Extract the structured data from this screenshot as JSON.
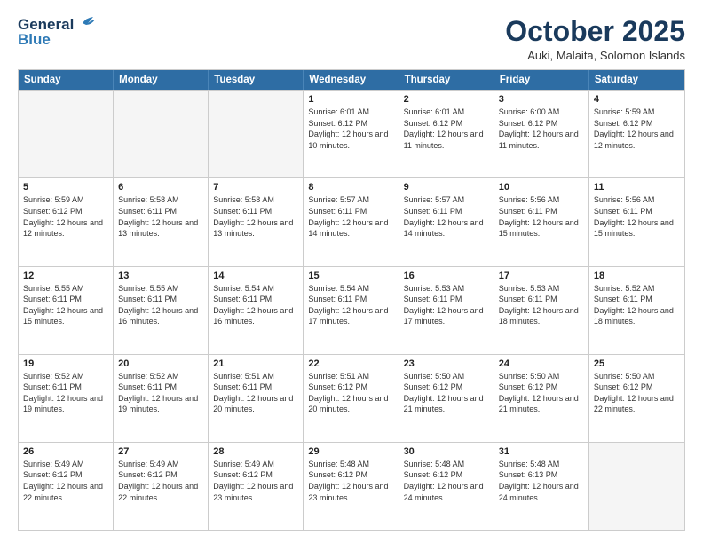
{
  "header": {
    "logo_general": "General",
    "logo_blue": "Blue",
    "month_title": "October 2025",
    "subtitle": "Auki, Malaita, Solomon Islands"
  },
  "calendar": {
    "days_of_week": [
      "Sunday",
      "Monday",
      "Tuesday",
      "Wednesday",
      "Thursday",
      "Friday",
      "Saturday"
    ],
    "weeks": [
      [
        {
          "day": "",
          "empty": true
        },
        {
          "day": "",
          "empty": true
        },
        {
          "day": "",
          "empty": true
        },
        {
          "day": "1",
          "sunrise": "Sunrise: 6:01 AM",
          "sunset": "Sunset: 6:12 PM",
          "daylight": "Daylight: 12 hours and 10 minutes."
        },
        {
          "day": "2",
          "sunrise": "Sunrise: 6:01 AM",
          "sunset": "Sunset: 6:12 PM",
          "daylight": "Daylight: 12 hours and 11 minutes."
        },
        {
          "day": "3",
          "sunrise": "Sunrise: 6:00 AM",
          "sunset": "Sunset: 6:12 PM",
          "daylight": "Daylight: 12 hours and 11 minutes."
        },
        {
          "day": "4",
          "sunrise": "Sunrise: 5:59 AM",
          "sunset": "Sunset: 6:12 PM",
          "daylight": "Daylight: 12 hours and 12 minutes."
        }
      ],
      [
        {
          "day": "5",
          "sunrise": "Sunrise: 5:59 AM",
          "sunset": "Sunset: 6:12 PM",
          "daylight": "Daylight: 12 hours and 12 minutes."
        },
        {
          "day": "6",
          "sunrise": "Sunrise: 5:58 AM",
          "sunset": "Sunset: 6:11 PM",
          "daylight": "Daylight: 12 hours and 13 minutes."
        },
        {
          "day": "7",
          "sunrise": "Sunrise: 5:58 AM",
          "sunset": "Sunset: 6:11 PM",
          "daylight": "Daylight: 12 hours and 13 minutes."
        },
        {
          "day": "8",
          "sunrise": "Sunrise: 5:57 AM",
          "sunset": "Sunset: 6:11 PM",
          "daylight": "Daylight: 12 hours and 14 minutes."
        },
        {
          "day": "9",
          "sunrise": "Sunrise: 5:57 AM",
          "sunset": "Sunset: 6:11 PM",
          "daylight": "Daylight: 12 hours and 14 minutes."
        },
        {
          "day": "10",
          "sunrise": "Sunrise: 5:56 AM",
          "sunset": "Sunset: 6:11 PM",
          "daylight": "Daylight: 12 hours and 15 minutes."
        },
        {
          "day": "11",
          "sunrise": "Sunrise: 5:56 AM",
          "sunset": "Sunset: 6:11 PM",
          "daylight": "Daylight: 12 hours and 15 minutes."
        }
      ],
      [
        {
          "day": "12",
          "sunrise": "Sunrise: 5:55 AM",
          "sunset": "Sunset: 6:11 PM",
          "daylight": "Daylight: 12 hours and 15 minutes."
        },
        {
          "day": "13",
          "sunrise": "Sunrise: 5:55 AM",
          "sunset": "Sunset: 6:11 PM",
          "daylight": "Daylight: 12 hours and 16 minutes."
        },
        {
          "day": "14",
          "sunrise": "Sunrise: 5:54 AM",
          "sunset": "Sunset: 6:11 PM",
          "daylight": "Daylight: 12 hours and 16 minutes."
        },
        {
          "day": "15",
          "sunrise": "Sunrise: 5:54 AM",
          "sunset": "Sunset: 6:11 PM",
          "daylight": "Daylight: 12 hours and 17 minutes."
        },
        {
          "day": "16",
          "sunrise": "Sunrise: 5:53 AM",
          "sunset": "Sunset: 6:11 PM",
          "daylight": "Daylight: 12 hours and 17 minutes."
        },
        {
          "day": "17",
          "sunrise": "Sunrise: 5:53 AM",
          "sunset": "Sunset: 6:11 PM",
          "daylight": "Daylight: 12 hours and 18 minutes."
        },
        {
          "day": "18",
          "sunrise": "Sunrise: 5:52 AM",
          "sunset": "Sunset: 6:11 PM",
          "daylight": "Daylight: 12 hours and 18 minutes."
        }
      ],
      [
        {
          "day": "19",
          "sunrise": "Sunrise: 5:52 AM",
          "sunset": "Sunset: 6:11 PM",
          "daylight": "Daylight: 12 hours and 19 minutes."
        },
        {
          "day": "20",
          "sunrise": "Sunrise: 5:52 AM",
          "sunset": "Sunset: 6:11 PM",
          "daylight": "Daylight: 12 hours and 19 minutes."
        },
        {
          "day": "21",
          "sunrise": "Sunrise: 5:51 AM",
          "sunset": "Sunset: 6:11 PM",
          "daylight": "Daylight: 12 hours and 20 minutes."
        },
        {
          "day": "22",
          "sunrise": "Sunrise: 5:51 AM",
          "sunset": "Sunset: 6:12 PM",
          "daylight": "Daylight: 12 hours and 20 minutes."
        },
        {
          "day": "23",
          "sunrise": "Sunrise: 5:50 AM",
          "sunset": "Sunset: 6:12 PM",
          "daylight": "Daylight: 12 hours and 21 minutes."
        },
        {
          "day": "24",
          "sunrise": "Sunrise: 5:50 AM",
          "sunset": "Sunset: 6:12 PM",
          "daylight": "Daylight: 12 hours and 21 minutes."
        },
        {
          "day": "25",
          "sunrise": "Sunrise: 5:50 AM",
          "sunset": "Sunset: 6:12 PM",
          "daylight": "Daylight: 12 hours and 22 minutes."
        }
      ],
      [
        {
          "day": "26",
          "sunrise": "Sunrise: 5:49 AM",
          "sunset": "Sunset: 6:12 PM",
          "daylight": "Daylight: 12 hours and 22 minutes."
        },
        {
          "day": "27",
          "sunrise": "Sunrise: 5:49 AM",
          "sunset": "Sunset: 6:12 PM",
          "daylight": "Daylight: 12 hours and 22 minutes."
        },
        {
          "day": "28",
          "sunrise": "Sunrise: 5:49 AM",
          "sunset": "Sunset: 6:12 PM",
          "daylight": "Daylight: 12 hours and 23 minutes."
        },
        {
          "day": "29",
          "sunrise": "Sunrise: 5:48 AM",
          "sunset": "Sunset: 6:12 PM",
          "daylight": "Daylight: 12 hours and 23 minutes."
        },
        {
          "day": "30",
          "sunrise": "Sunrise: 5:48 AM",
          "sunset": "Sunset: 6:12 PM",
          "daylight": "Daylight: 12 hours and 24 minutes."
        },
        {
          "day": "31",
          "sunrise": "Sunrise: 5:48 AM",
          "sunset": "Sunset: 6:13 PM",
          "daylight": "Daylight: 12 hours and 24 minutes."
        },
        {
          "day": "",
          "empty": true
        }
      ]
    ]
  }
}
